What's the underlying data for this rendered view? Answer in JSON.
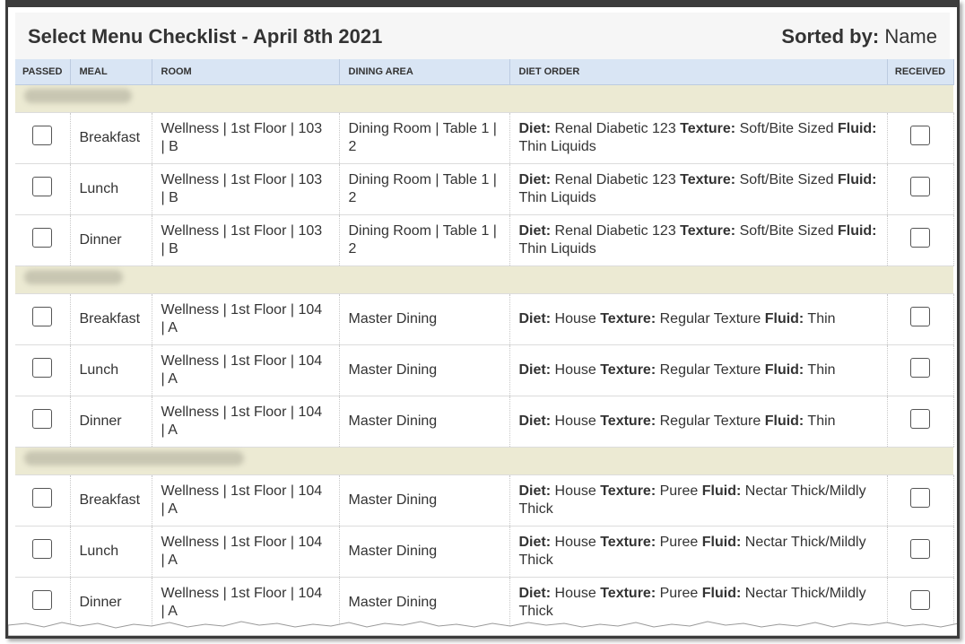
{
  "header": {
    "title": "Select Menu Checklist - April 8th 2021",
    "sorted_label": "Sorted by:",
    "sorted_value": "Name"
  },
  "columns": [
    "PASSED",
    "MEAL",
    "ROOM",
    "DINING AREA",
    "DIET ORDER",
    "RECEIVED"
  ],
  "labels": {
    "diet": "Diet:",
    "texture": "Texture:",
    "fluid": "Fluid:"
  },
  "groups": [
    {
      "rows": [
        {
          "meal": "Breakfast",
          "room": "Wellness | 1st Floor | 103 | B",
          "dining": "Dining Room | Table 1 | 2",
          "diet": "Renal Diabetic 123",
          "texture": "Soft/Bite Sized",
          "fluid": "Thin Liquids"
        },
        {
          "meal": "Lunch",
          "room": "Wellness | 1st Floor | 103 | B",
          "dining": "Dining Room | Table 1 | 2",
          "diet": "Renal Diabetic 123",
          "texture": "Soft/Bite Sized",
          "fluid": "Thin Liquids"
        },
        {
          "meal": "Dinner",
          "room": "Wellness | 1st Floor | 103 | B",
          "dining": "Dining Room | Table 1 | 2",
          "diet": "Renal Diabetic 123",
          "texture": "Soft/Bite Sized",
          "fluid": "Thin Liquids"
        }
      ]
    },
    {
      "rows": [
        {
          "meal": "Breakfast",
          "room": "Wellness | 1st Floor | 104 | A",
          "dining": "Master Dining",
          "diet": "House",
          "texture": "Regular Texture",
          "fluid": "Thin"
        },
        {
          "meal": "Lunch",
          "room": "Wellness | 1st Floor | 104 | A",
          "dining": "Master Dining",
          "diet": "House",
          "texture": "Regular Texture",
          "fluid": "Thin"
        },
        {
          "meal": "Dinner",
          "room": "Wellness | 1st Floor | 104 | A",
          "dining": "Master Dining",
          "diet": "House",
          "texture": "Regular Texture",
          "fluid": "Thin"
        }
      ]
    },
    {
      "rows": [
        {
          "meal": "Breakfast",
          "room": "Wellness | 1st Floor | 104 | A",
          "dining": "Master Dining",
          "diet": "House",
          "texture": "Puree",
          "fluid": "Nectar Thick/Mildly Thick"
        },
        {
          "meal": "Lunch",
          "room": "Wellness | 1st Floor | 104 | A",
          "dining": "Master Dining",
          "diet": "House",
          "texture": "Puree",
          "fluid": "Nectar Thick/Mildly Thick"
        },
        {
          "meal": "Dinner",
          "room": "Wellness | 1st Floor | 104 | A",
          "dining": "Master Dining",
          "diet": "House",
          "texture": "Puree",
          "fluid": "Nectar Thick/Mildly Thick"
        }
      ]
    }
  ]
}
